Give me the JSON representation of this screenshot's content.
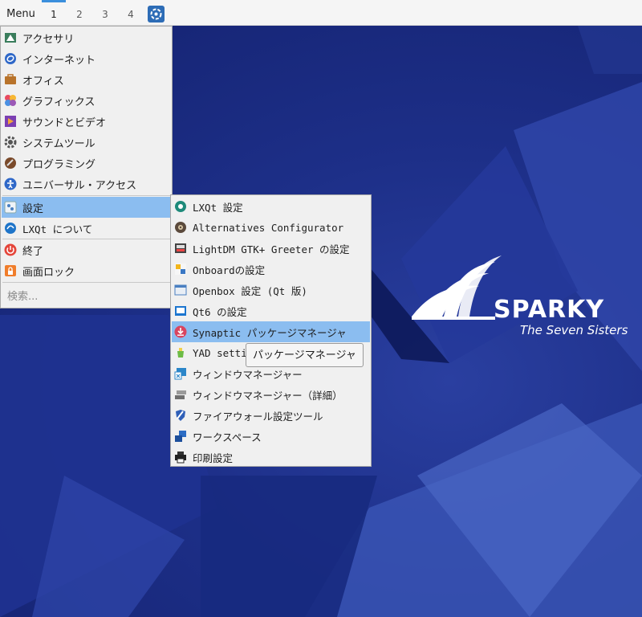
{
  "panel": {
    "menu_label": "Menu",
    "desktops": [
      "1",
      "2",
      "3",
      "4"
    ],
    "active_desktop": "1",
    "launcher_icon": "sparky-launcher-icon"
  },
  "main_menu": {
    "items": [
      {
        "label": "アクセサリ",
        "icon": "accessories-icon"
      },
      {
        "label": "インターネット",
        "icon": "internet-icon"
      },
      {
        "label": "オフィス",
        "icon": "office-icon"
      },
      {
        "label": "グラフィックス",
        "icon": "graphics-icon"
      },
      {
        "label": "サウンドとビデオ",
        "icon": "multimedia-icon"
      },
      {
        "label": "システムツール",
        "icon": "system-tools-icon"
      },
      {
        "label": "プログラミング",
        "icon": "programming-icon"
      },
      {
        "label": "ユニバーサル・アクセス",
        "icon": "accessibility-icon"
      },
      {
        "label": "設定",
        "icon": "settings-icon"
      },
      {
        "label": "LXQt について",
        "icon": "lxqt-about-icon"
      },
      {
        "label": "終了",
        "icon": "power-icon"
      },
      {
        "label": "画面ロック",
        "icon": "lock-icon"
      }
    ],
    "search_placeholder": "検索..."
  },
  "settings_submenu": {
    "items": [
      {
        "label": "LXQt 設定",
        "icon": "lxqt-settings-icon"
      },
      {
        "label": "Alternatives Configurator",
        "icon": "alternatives-icon"
      },
      {
        "label": "LightDM GTK+ Greeter の設定",
        "icon": "lightdm-icon"
      },
      {
        "label": "Onboardの設定",
        "icon": "onboard-icon"
      },
      {
        "label": "Openbox 設定 (Qt 版)",
        "icon": "openbox-icon"
      },
      {
        "label": "Qt6 の設定",
        "icon": "qt6-icon"
      },
      {
        "label": "Synaptic パッケージマネージャ",
        "icon": "synaptic-icon"
      },
      {
        "label": "YAD settin",
        "icon": "yad-icon"
      },
      {
        "label": "ウィンドウマネージャー",
        "icon": "window-manager-icon"
      },
      {
        "label": "ウィンドウマネージャー（詳細）",
        "icon": "window-manager-advanced-icon"
      },
      {
        "label": "ファイアウォール設定ツール",
        "icon": "firewall-icon"
      },
      {
        "label": "ワークスペース",
        "icon": "workspace-icon"
      },
      {
        "label": "印刷設定",
        "icon": "printer-icon"
      }
    ]
  },
  "tooltip": "パッケージマネージャ",
  "wallpaper": {
    "brand": "SPARKY",
    "tagline": "The Seven Sisters"
  },
  "colors": {
    "selection": "#8bbdf0",
    "desktop_indicator": "#3b8fdc",
    "wallpaper": "#1d2f88"
  }
}
